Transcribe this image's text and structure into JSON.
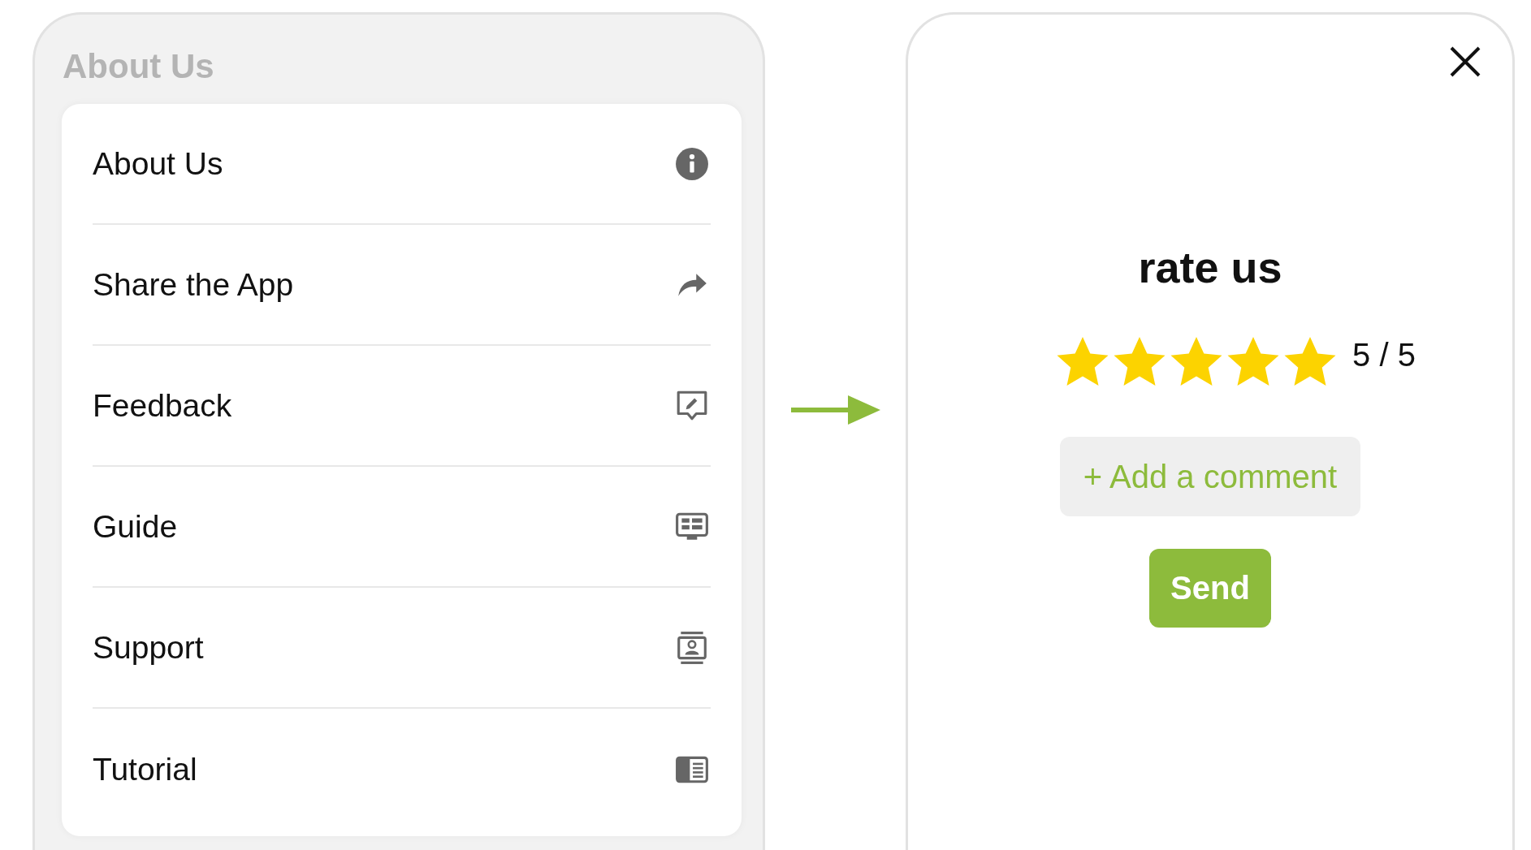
{
  "menu_panel": {
    "title": "About Us",
    "items": [
      {
        "label": "About Us"
      },
      {
        "label": "Share the App"
      },
      {
        "label": "Feedback"
      },
      {
        "label": "Guide"
      },
      {
        "label": "Support"
      },
      {
        "label": "Tutorial"
      }
    ]
  },
  "rating_panel": {
    "title": "rate us",
    "stars": 5,
    "score": "5 / 5",
    "comment_button": "+ Add a comment",
    "send_button": "Send"
  }
}
